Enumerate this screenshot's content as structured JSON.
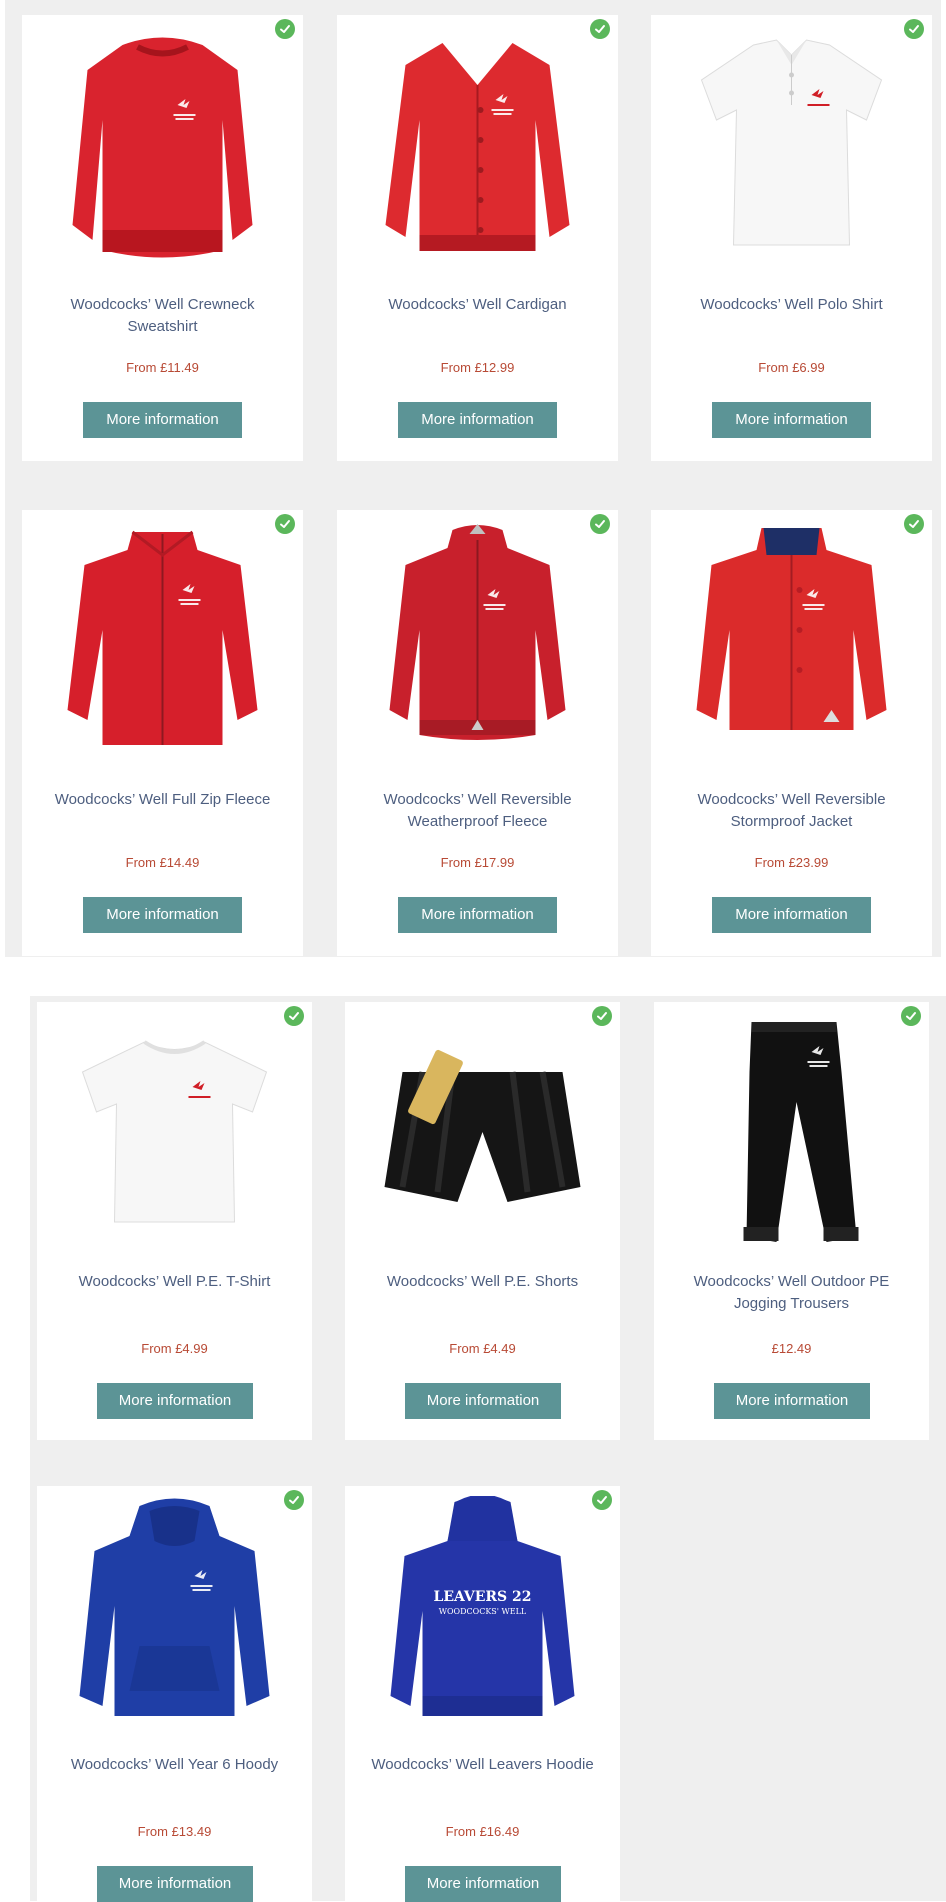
{
  "colors": {
    "check": "#5bb75b",
    "button": "#5c9496",
    "title": "#4d5e7f",
    "price": "#b84a35",
    "panel": "#efefef"
  },
  "button_label": "More information",
  "products": [
    {
      "title": "Woodcocks’ Well Crewneck Sweatshirt",
      "price": "From £11.49",
      "garment": "sweatshirt",
      "color": "#d9232e"
    },
    {
      "title": "Woodcocks’ Well Cardigan",
      "price": "From £12.99",
      "garment": "cardigan",
      "color": "#dd2a2f"
    },
    {
      "title": "Woodcocks’ Well Polo Shirt",
      "price": "From £6.99",
      "garment": "polo",
      "color": "#f7f7f7"
    },
    {
      "title": "Woodcocks’ Well Full Zip Fleece",
      "price": "From £14.49",
      "garment": "fleece",
      "color": "#d61f2b"
    },
    {
      "title": "Woodcocks’ Well Reversible Weatherproof Fleece",
      "price": "From £17.99",
      "garment": "jacket",
      "color": "#c8202c"
    },
    {
      "title": "Woodcocks’ Well Reversible Stormproof Jacket",
      "price": "From £23.99",
      "garment": "storm-jacket",
      "color": "#db2b2b"
    },
    {
      "title": "Woodcocks’ Well P.E. T-Shirt",
      "price": "From £4.99",
      "garment": "tshirt",
      "color": "#f7f7f7"
    },
    {
      "title": "Woodcocks’ Well P.E. Shorts",
      "price": "From £4.49",
      "garment": "shorts",
      "color": "#151515"
    },
    {
      "title": "Woodcocks’ Well Outdoor PE Jogging Trousers",
      "price": "£12.49",
      "garment": "trousers",
      "color": "#111111"
    },
    {
      "title": "Woodcocks’ Well Year 6 Hoody",
      "price": "From £13.49",
      "garment": "hoody",
      "color": "#1f3ea6"
    },
    {
      "title": "Woodcocks’ Well Leavers Hoodie",
      "price": "From £16.49",
      "garment": "hoodie-back",
      "color": "#2535a8"
    }
  ],
  "leavers_print": {
    "line1": "LEAVERS 22",
    "line2": "WOODCOCKS' WELL"
  }
}
